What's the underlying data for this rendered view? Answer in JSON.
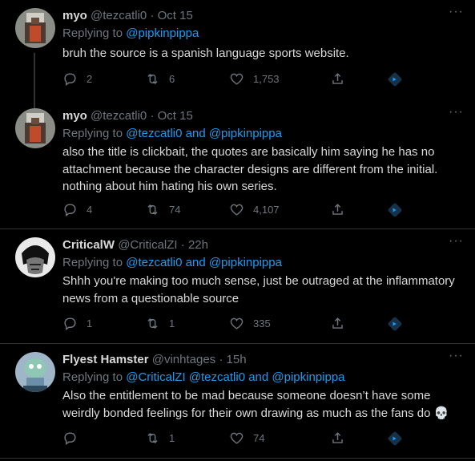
{
  "tweets": [
    {
      "name": "myo",
      "handle": "@tezcatli0",
      "dot": "·",
      "time": "Oct 15",
      "replying_prefix": "Replying to",
      "replying_to": "@pipkinpippa",
      "text": "bruh the source is a spanish language sports website.",
      "reply_count": "2",
      "retweet_count": "6",
      "like_count": "1,753"
    },
    {
      "name": "myo",
      "handle": "@tezcatli0",
      "dot": "·",
      "time": "Oct 15",
      "replying_prefix": "Replying to",
      "replying_to": "@tezcatli0 and @pipkinpippa",
      "text": "also the title is clickbait, the quotes are basically him saying he has no attachment because the character designs are different from the initial. nothing about him hating his own series.",
      "reply_count": "4",
      "retweet_count": "74",
      "like_count": "4,107"
    },
    {
      "name": "CriticalW",
      "handle": "@CriticalZI",
      "dot": "·",
      "time": "22h",
      "replying_prefix": "Replying to",
      "replying_to": "@tezcatli0 and @pipkinpippa",
      "text": "Shhh you're making too much sense, just be outraged at the inflammatory news from a questionable source",
      "reply_count": "1",
      "retweet_count": "1",
      "like_count": "335"
    },
    {
      "name": "Flyest Hamster",
      "handle": "@vinhtages",
      "dot": "·",
      "time": "15h",
      "replying_prefix": "Replying to",
      "replying_to": "@CriticalZI @tezcatli0 and @pipkinpippa",
      "text": "Also the entitlement to be mad because someone doesn’t have some weirdly bonded feelings for their own drawing as much as the fans do 💀",
      "reply_count": "",
      "retweet_count": "1",
      "like_count": "74"
    }
  ],
  "more_glyph": "···",
  "colors": {
    "background": "#000000",
    "text": "#d9d9d9",
    "muted": "#6e767d",
    "link": "#1d9bf0",
    "divider": "#2f3336"
  },
  "icons": [
    "reply-icon",
    "retweet-icon",
    "like-icon",
    "share-icon",
    "analytics-icon",
    "more-icon"
  ]
}
